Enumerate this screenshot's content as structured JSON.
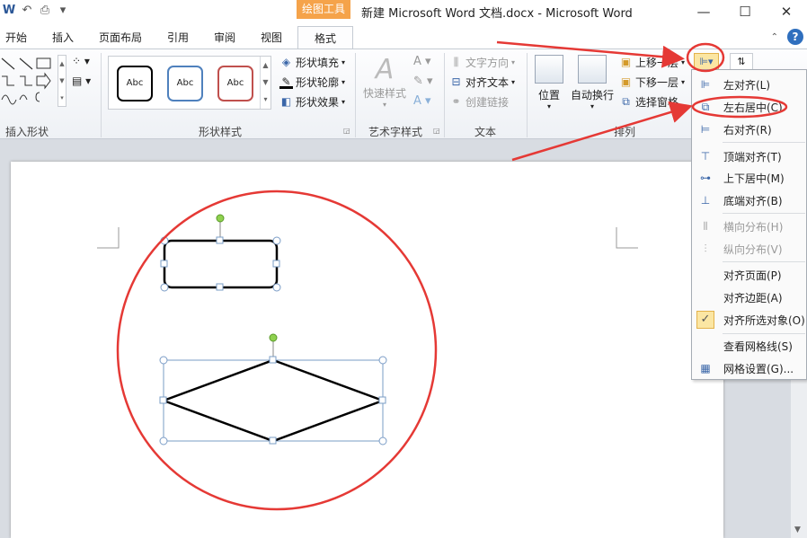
{
  "window": {
    "title": "新建 Microsoft Word 文档.docx  -  Microsoft Word",
    "context_tab_group": "绘图工具",
    "controls": {
      "minimize": "—",
      "maximize": "☐",
      "close": "✕"
    }
  },
  "tabs": [
    {
      "label": "开始"
    },
    {
      "label": "插入"
    },
    {
      "label": "页面布局"
    },
    {
      "label": "引用"
    },
    {
      "label": "审阅"
    },
    {
      "label": "视图"
    },
    {
      "label": "格式"
    }
  ],
  "ribbon": {
    "insert_shapes": {
      "label": "插入形状"
    },
    "shape_styles": {
      "label": "形状样式",
      "gallery": [
        "Abc",
        "Abc",
        "Abc"
      ],
      "gallery_border_colors": [
        "#000000",
        "#4f81bd",
        "#c0504d"
      ],
      "fill": "形状填充",
      "outline": "形状轮廓",
      "effects": "形状效果"
    },
    "wordart": {
      "label": "艺术字样式",
      "quick_styles": "快速样式"
    },
    "text": {
      "label": "文本",
      "direction": "文字方向",
      "align": "对齐文本",
      "link": "创建链接"
    },
    "arrange": {
      "label": "排列",
      "position": "位置",
      "wrap": "自动换行",
      "bring_forward": "上移一层",
      "send_backward": "下移一层",
      "selection_pane": "选择窗格"
    }
  },
  "align_menu": {
    "items": [
      {
        "label": "左对齐(L)",
        "enabled": true
      },
      {
        "label": "左右居中(C)",
        "enabled": true
      },
      {
        "label": "右对齐(R)",
        "enabled": true
      },
      {
        "label": "顶端对齐(T)",
        "enabled": true
      },
      {
        "label": "上下居中(M)",
        "enabled": true
      },
      {
        "label": "底端对齐(B)",
        "enabled": true
      },
      {
        "label": "横向分布(H)",
        "enabled": false
      },
      {
        "label": "纵向分布(V)",
        "enabled": false
      },
      {
        "label": "对齐页面(P)",
        "enabled": true
      },
      {
        "label": "对齐边距(A)",
        "enabled": true
      },
      {
        "label": "对齐所选对象(O)",
        "enabled": true,
        "checked": true
      },
      {
        "label": "查看网格线(S)",
        "enabled": true
      },
      {
        "label": "网格设置(G)...",
        "enabled": true
      }
    ]
  },
  "colors": {
    "annotation_red": "#e53935",
    "context_orange": "#f5a34a",
    "handle_green": "#8fd14f",
    "selection_blue": "#7a9cc6"
  }
}
